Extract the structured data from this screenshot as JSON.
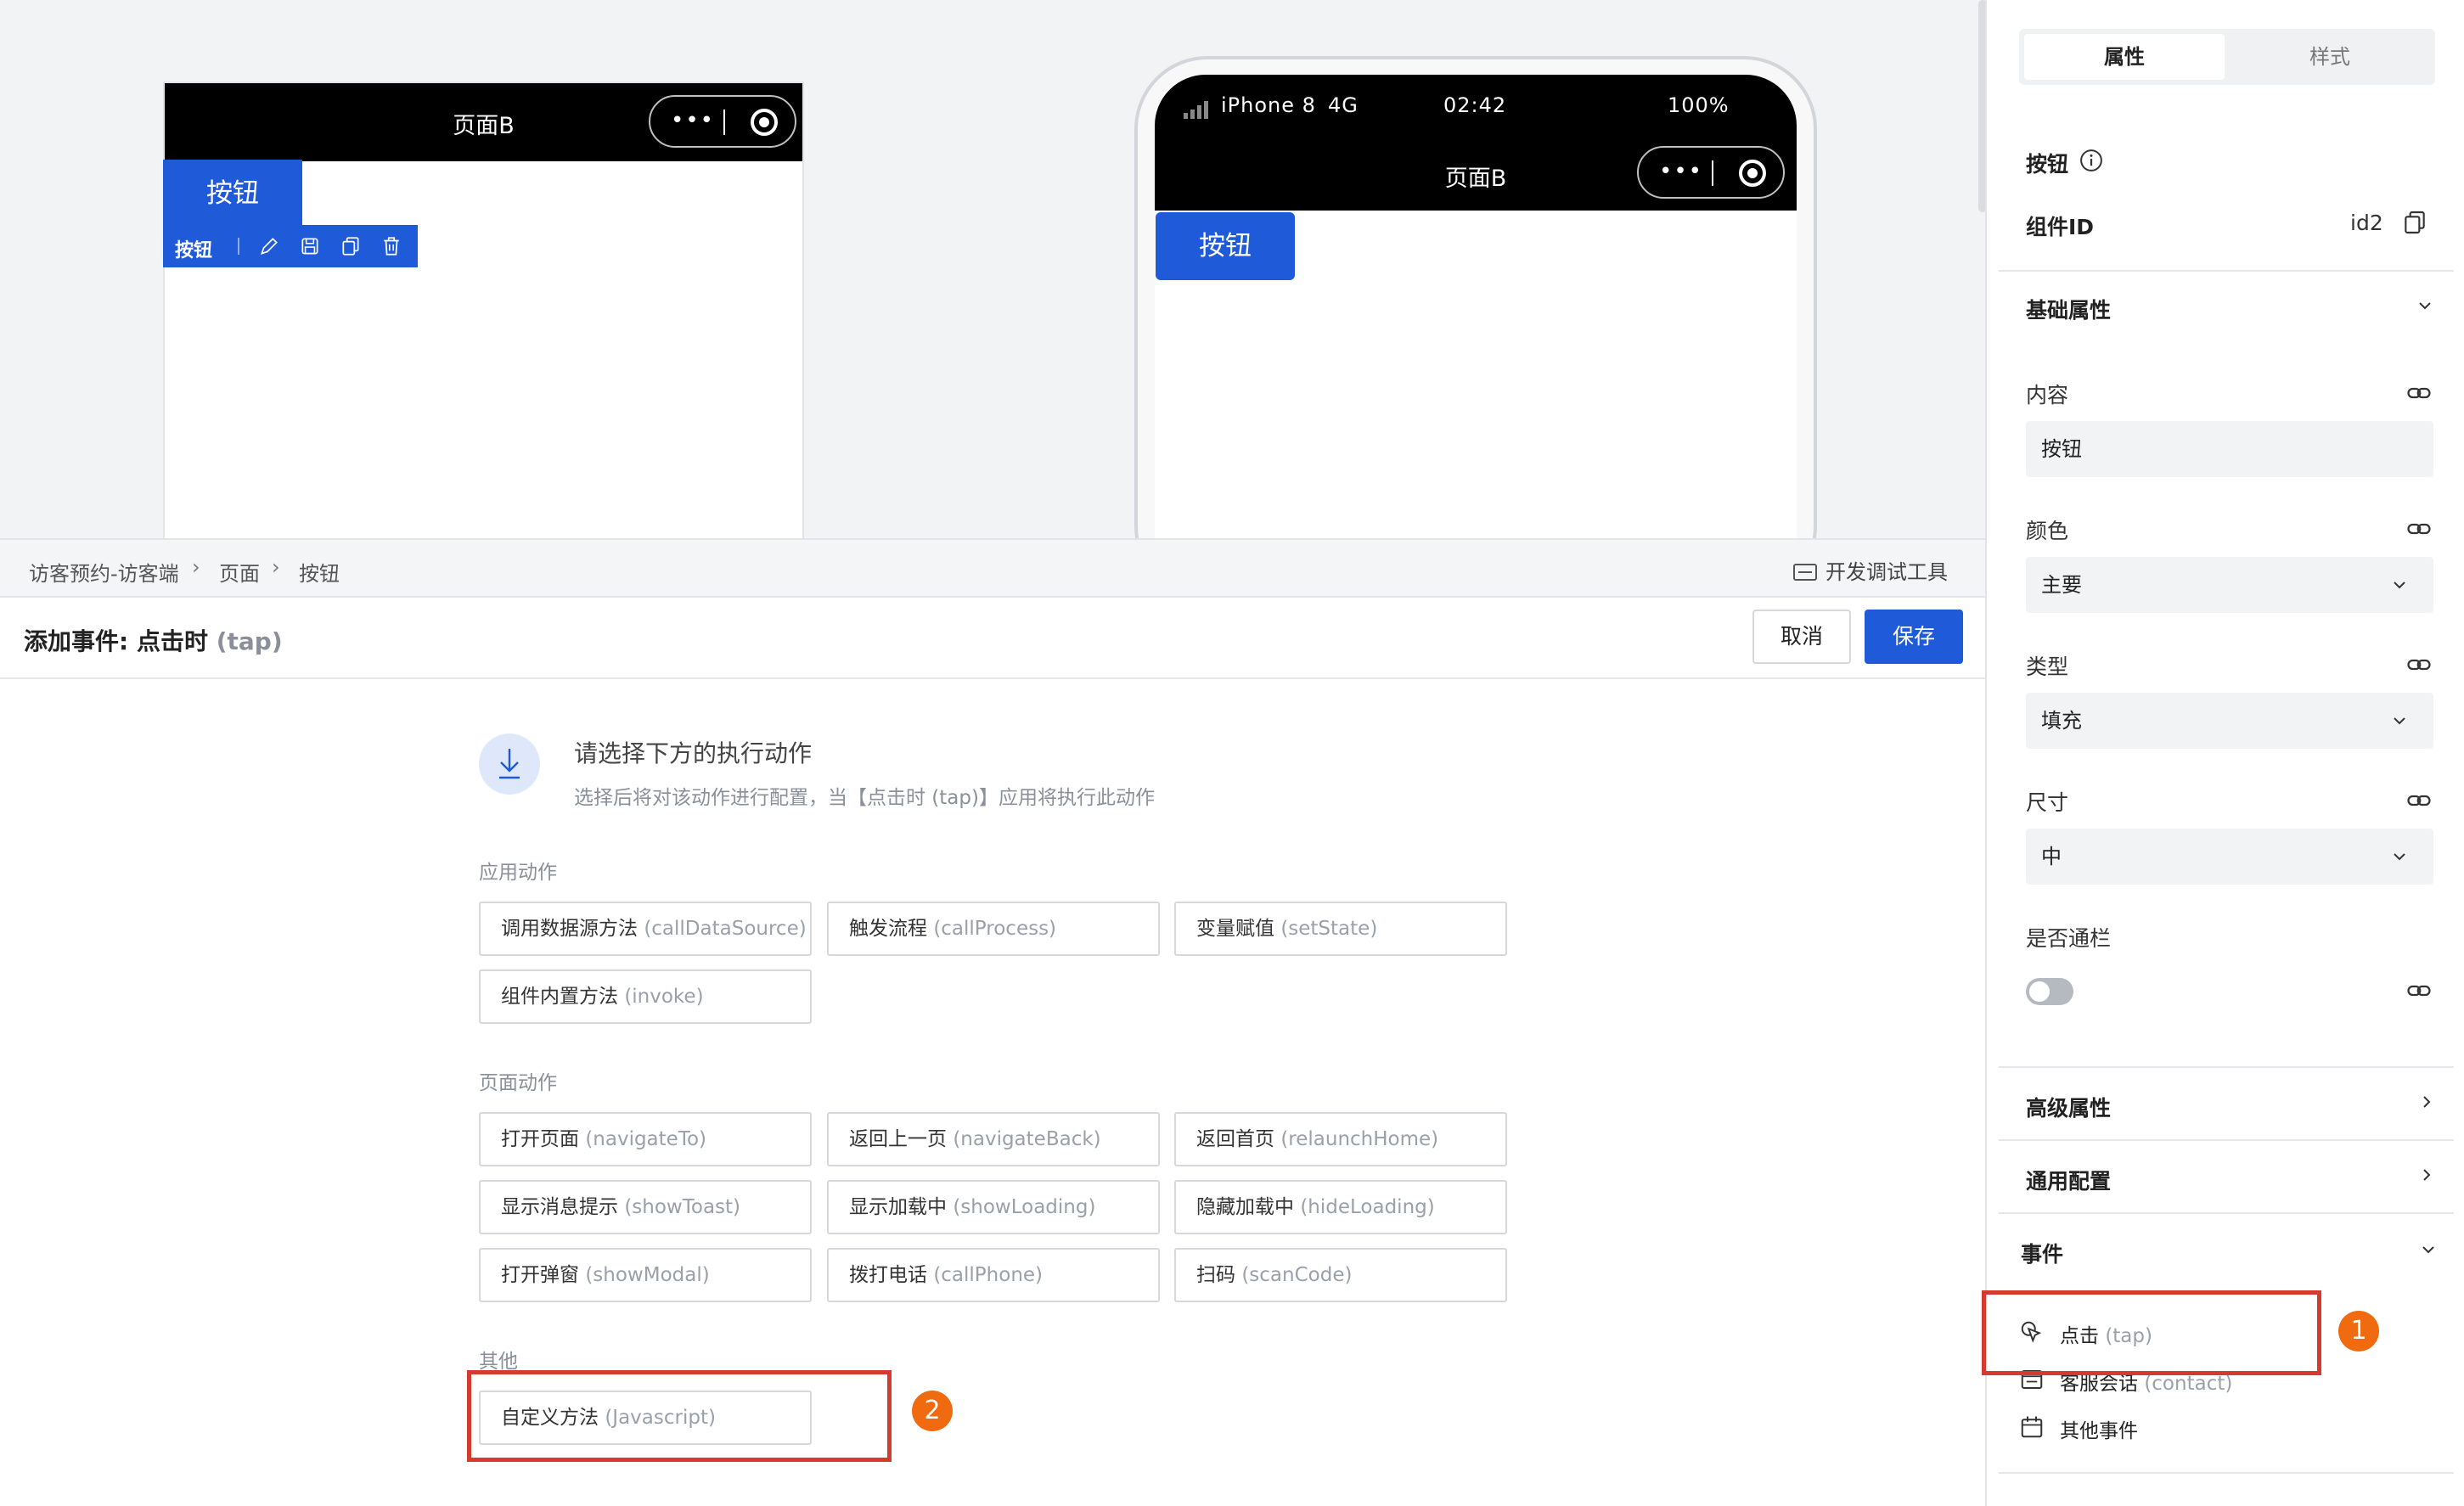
{
  "canvas": {
    "preview_a": {
      "nav_title": "页面B",
      "selected_button_label": "按钮",
      "toolbar_label": "按钮"
    },
    "phone": {
      "carrier": "iPhone 8",
      "network": "4G",
      "time": "02:42",
      "battery": "100%",
      "nav_title": "页面B",
      "button_label": "按钮"
    }
  },
  "breadcrumb": {
    "items": [
      "访客预约-访客端",
      "页面",
      "按钮"
    ],
    "separator": "›",
    "devtools_label": "开发调试工具"
  },
  "event_header": {
    "title": "添加事件: 点击时",
    "title_suffix": "(tap)",
    "cancel_label": "取消",
    "save_label": "保存"
  },
  "hint": {
    "title": "请选择下方的执行动作",
    "desc": "选择后将对该动作进行配置，当【点击时 (tap)】应用将执行此动作"
  },
  "groups": [
    {
      "label": "应用动作",
      "actions": [
        {
          "zh": "调用数据源方法",
          "en": "(callDataSource)"
        },
        {
          "zh": "触发流程",
          "en": "(callProcess)"
        },
        {
          "zh": "变量赋值",
          "en": "(setState)"
        },
        {
          "zh": "组件内置方法",
          "en": "(invoke)"
        }
      ]
    },
    {
      "label": "页面动作",
      "actions": [
        {
          "zh": "打开页面",
          "en": "(navigateTo)"
        },
        {
          "zh": "返回上一页",
          "en": "(navigateBack)"
        },
        {
          "zh": "返回首页",
          "en": "(relaunchHome)"
        },
        {
          "zh": "显示消息提示",
          "en": "(showToast)"
        },
        {
          "zh": "显示加载中",
          "en": "(showLoading)"
        },
        {
          "zh": "隐藏加载中",
          "en": "(hideLoading)"
        },
        {
          "zh": "打开弹窗",
          "en": "(showModal)"
        },
        {
          "zh": "拨打电话",
          "en": "(callPhone)"
        },
        {
          "zh": "扫码",
          "en": "(scanCode)"
        }
      ]
    },
    {
      "label": "其他",
      "actions": [
        {
          "zh": "自定义方法",
          "en": "(Javascript)"
        }
      ]
    }
  ],
  "annotations": {
    "badge_1": "1",
    "badge_2": "2",
    "highlight_color": "#d63a2e",
    "badge_color": "#f06a0f"
  },
  "panel": {
    "tabs": [
      "属性",
      "样式"
    ],
    "component_name": "按钮",
    "component_id_label": "组件ID",
    "component_id_value": "id2",
    "basic_section": "基础属性",
    "fields": {
      "content_label": "内容",
      "content_value": "按钮",
      "color_label": "颜色",
      "color_value": "主要",
      "type_label": "类型",
      "type_value": "填充",
      "size_label": "尺寸",
      "size_value": "中",
      "fullwidth_label": "是否通栏"
    },
    "advanced_section": "高级属性",
    "common_section": "通用配置",
    "events_section": "事件",
    "events": [
      {
        "zh": "点击",
        "en": "(tap)"
      },
      {
        "zh": "客服会话",
        "en": "(contact)"
      },
      {
        "zh": "其他事件",
        "en": ""
      }
    ]
  },
  "colors": {
    "accent": "#1f5bd8",
    "canvas_bg": "#f2f3f5"
  }
}
